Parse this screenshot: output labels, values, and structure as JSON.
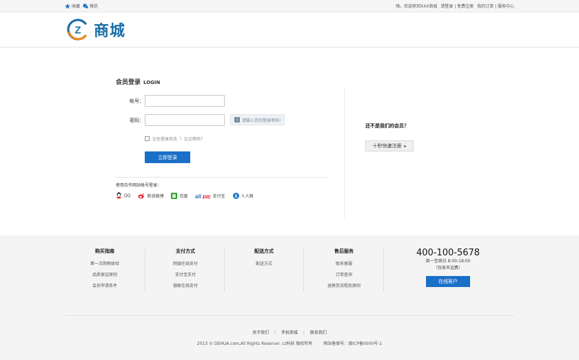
{
  "topbar": {
    "favorite": "收藏",
    "wechat": "微信",
    "welcome": "嗨，欢迎来到XXX商城",
    "login": "请登录",
    "sep": "|",
    "register": "免费注册",
    "orders": "我的订单",
    "service": "服务中心"
  },
  "logo": {
    "text": "商城",
    "mark": "Z",
    "color": "#1b6ea8"
  },
  "login": {
    "title": "会员登录",
    "title_en": "LOGIN",
    "account_label": "帐号：",
    "password_label": "密码：",
    "account_value": "",
    "password_value": "",
    "tip": "请输入您的登录密码!",
    "remember": "记住登录状态",
    "divider": "|",
    "forgot": "忘记密码？",
    "submit": "立即登录",
    "partner_title": "使用合作网站帐号登录：",
    "partners": [
      "QQ",
      "新浪微博",
      "百度",
      "支付宝",
      "人人网"
    ]
  },
  "register": {
    "question": "还不是我们的会员？",
    "button": "十秒快速注册",
    "arrow": "▸"
  },
  "footer": {
    "columns": [
      {
        "title": "购买指南",
        "links": [
          "第一次购物体验",
          "品质保证原则",
          "会员申请条件"
        ]
      },
      {
        "title": "支付方式",
        "links": [
          "网银在线支付",
          "支付宝支付",
          "银联在线支付"
        ]
      },
      {
        "title": "配送方式",
        "links": [
          "配送方式"
        ]
      },
      {
        "title": "售后服务",
        "links": [
          "联系客服",
          "订单查询",
          "退换货流程及原则"
        ]
      }
    ],
    "hotline": "400-100-5678",
    "hours": "周一至周日 8:00-18:00",
    "hours_note": "（仅收市话费）",
    "online_service": "在线客户",
    "links": [
      "关于我们",
      "手机商城",
      "联系我们"
    ],
    "link_sep": "|",
    "copyright": "2013 © DEHUA.com,All Rights Reserver. cz科技 版权所有",
    "icp": "网站备案号：闽ICP备0000号-1"
  },
  "colors": {
    "accent": "#1a6fc7",
    "brand": "#1b6ea8"
  }
}
